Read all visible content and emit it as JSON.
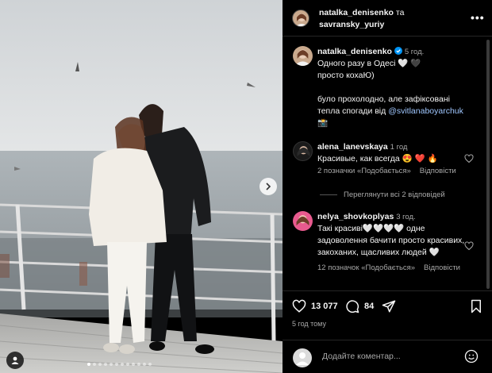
{
  "post": {
    "authors": {
      "user1": "natalka_denisenko",
      "joiner": "та",
      "user2": "savransky_yuriy"
    },
    "more_label": "•••"
  },
  "caption": {
    "username": "natalka_denisenko",
    "time": "5 год.",
    "line1": "Одного разу в Одесі 🤍 🖤",
    "line2": "просто кохаЮ)",
    "line3": "було прохолодно, але зафіксовані",
    "line4_pre": "тепла спогади від ",
    "mention": "@svitlanaboyarchuk",
    "line5": "📸"
  },
  "comments": [
    {
      "username": "alena_lanevskaya",
      "time": "1 год",
      "text": "Красивые, как всегда 😍 ❤️ 🔥",
      "likes": "2 позначки «Подобається»",
      "reply": "Відповісти"
    },
    {
      "username": "nelya_shovkoplyas",
      "time": "3 год.",
      "text": "Такі красиві🤍🤍🤍🤍 одне задоволення бачити просто красивих, закоханих, щасливих людей 🤍",
      "likes": "12 позначок «Подобається»",
      "reply": "Відповісти"
    }
  ],
  "view_replies": "Переглянути всі 2 відповідей",
  "actions": {
    "likes_count": "13 077",
    "comments_count": "84",
    "posted": "5 год тому"
  },
  "add_comment": {
    "placeholder": "Додайте коментар..."
  },
  "carousel": {
    "slide_count": 12,
    "active_index": 0
  },
  "colors": {
    "background": "#000000",
    "link": "#a0c7ff",
    "verified": "#0095f6",
    "muted": "#a8a8a8",
    "like_red": "#ff3040"
  },
  "icons": [
    "heart-icon",
    "comment-icon",
    "share-icon",
    "bookmark-icon",
    "emoji-icon",
    "verified-icon",
    "chevron-right-icon",
    "user-tag-icon",
    "more-icon"
  ]
}
